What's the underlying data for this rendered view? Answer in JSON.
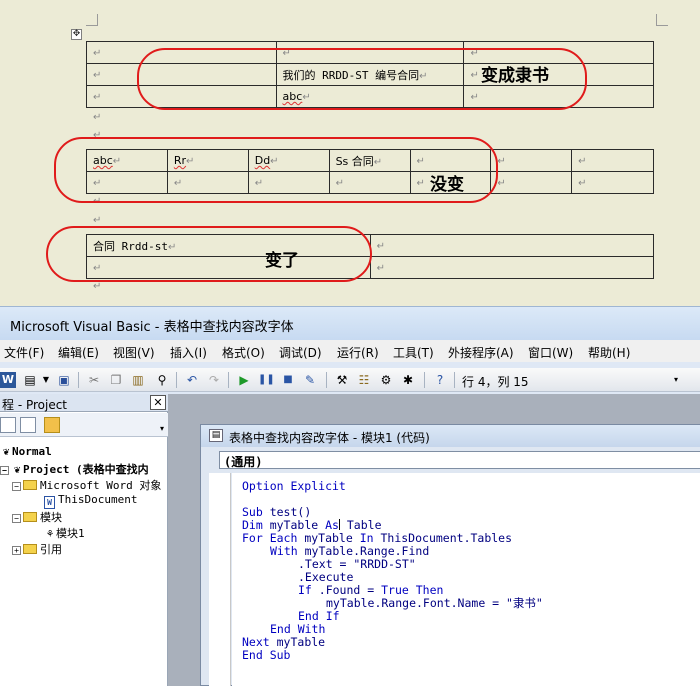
{
  "word_doc": {
    "table1": {
      "row2_text": "我们的 RRDD-ST 编号合同",
      "row3_text": "abc"
    },
    "table2": {
      "cells": [
        "abc",
        "Rr",
        "Dd",
        "Ss 合同"
      ]
    },
    "table3": {
      "text": "合同 Rrdd-st"
    },
    "para_mark": "↵",
    "annotations": {
      "a1": "变成隶书",
      "a2": "没变",
      "a3": "变了"
    }
  },
  "vba": {
    "title": "Microsoft Visual Basic - 表格中查找内容改字体",
    "menu": [
      "文件(F)",
      "编辑(E)",
      "视图(V)",
      "插入(I)",
      "格式(O)",
      "调试(D)",
      "运行(R)",
      "工具(T)",
      "外接程序(A)",
      "窗口(W)",
      "帮助(H)"
    ],
    "position": "行 4，列 15",
    "project_panel": {
      "title": "程 - Project",
      "close": "✕",
      "tree": [
        "Normal",
        "Project (表格中查找内",
        "Microsoft Word 对象",
        "ThisDocument",
        "模块",
        "模块1",
        "引用"
      ]
    },
    "code_window": {
      "title": "表格中查找内容改字体 - 模块1 (代码)",
      "object_dropdown": "(通用)",
      "lines": {
        "l1": "Option Explicit",
        "l3_kw": "Sub",
        "l3_rest": " test()",
        "l4_kw": "Dim",
        "l4_a": " myTable ",
        "l4_kw2": "As",
        "l4_b": " Table",
        "l5_kw": "For Each",
        "l5_a": " myTable ",
        "l5_kw2": "In",
        "l5_b": " ThisDocument.Tables",
        "l6_kw": "With",
        "l6_rest": " myTable.Range.Find",
        "l7": ".Text = \"RRDD-ST\"",
        "l8": ".Execute",
        "l9_kw": "If",
        "l9_a": " .Found = ",
        "l9_kw2": "True Then",
        "l10": "myTable.Range.Font.Name = \"隶书\"",
        "l11": "End If",
        "l12": "End With",
        "l13_kw": "Next",
        "l13_rest": " myTable",
        "l14": "End Sub"
      }
    }
  },
  "colors": {
    "doc_bg": "#ecebd6",
    "highlight_ellipse": "#e01b1b",
    "keyword": "#0000c0"
  }
}
